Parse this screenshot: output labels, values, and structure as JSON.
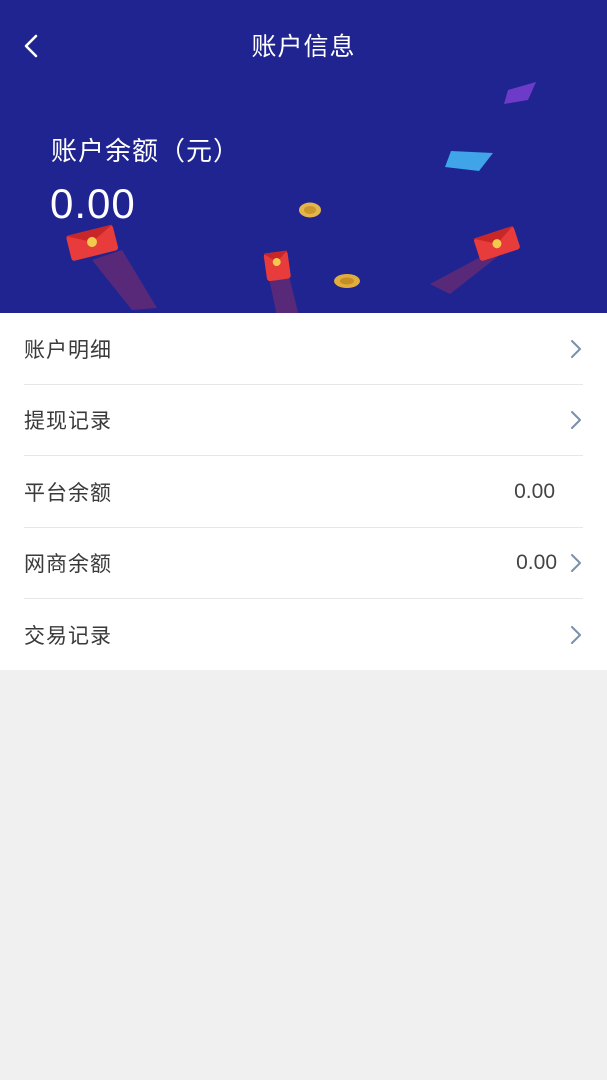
{
  "header": {
    "title": "账户信息",
    "back_icon": "chevron-left-icon",
    "background_color": "#1f2490"
  },
  "balance": {
    "label": "账户余额（元）",
    "value": "0.00"
  },
  "menu": {
    "items": [
      {
        "label": "账户明细",
        "value": "",
        "icon": "chevron-right-icon"
      },
      {
        "label": "提现记录",
        "value": "",
        "icon": "chevron-right-icon"
      },
      {
        "label": "平台余额",
        "value": "0.00",
        "icon": ""
      },
      {
        "label": "网商余额",
        "value": "0.00",
        "icon": "chevron-right-icon"
      },
      {
        "label": "交易记录",
        "value": "",
        "icon": "chevron-right-icon"
      }
    ]
  },
  "decorations": [
    "red-envelope-icon",
    "gold-coin-icon",
    "flying-paper-icon"
  ]
}
